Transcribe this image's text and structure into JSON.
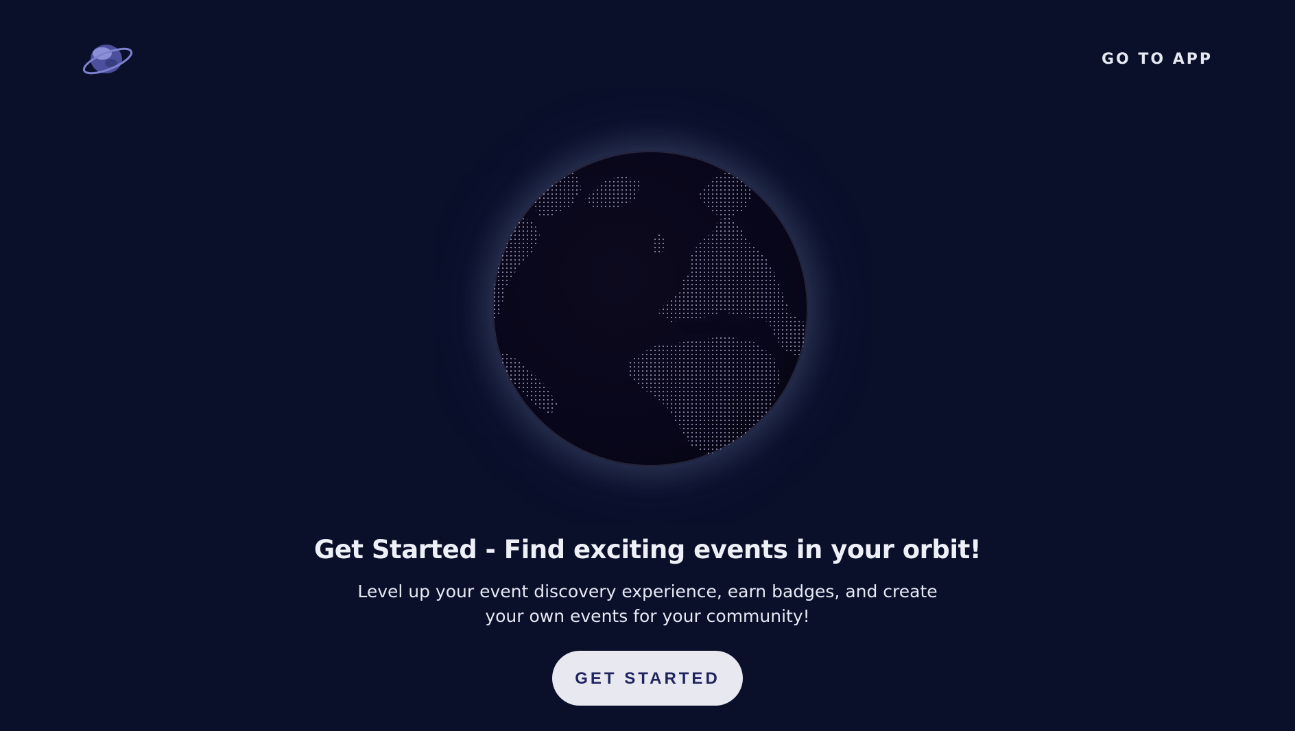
{
  "header": {
    "logo_icon": "planet-logo-icon",
    "nav_link_label": "GO TO APP"
  },
  "hero": {
    "globe_icon": "dotted-globe-icon",
    "headline": "Get Started - Find exciting events in your orbit!",
    "subtext": "Level up your event discovery experience, earn badges, and create your own events for your community!",
    "cta_label": "GET STARTED"
  },
  "colors": {
    "background": "#0a0f2a",
    "text": "#eef0f7",
    "button_bg": "#e7e8f0",
    "button_text": "#1f2460",
    "logo_accent": "#6b6fc4"
  }
}
